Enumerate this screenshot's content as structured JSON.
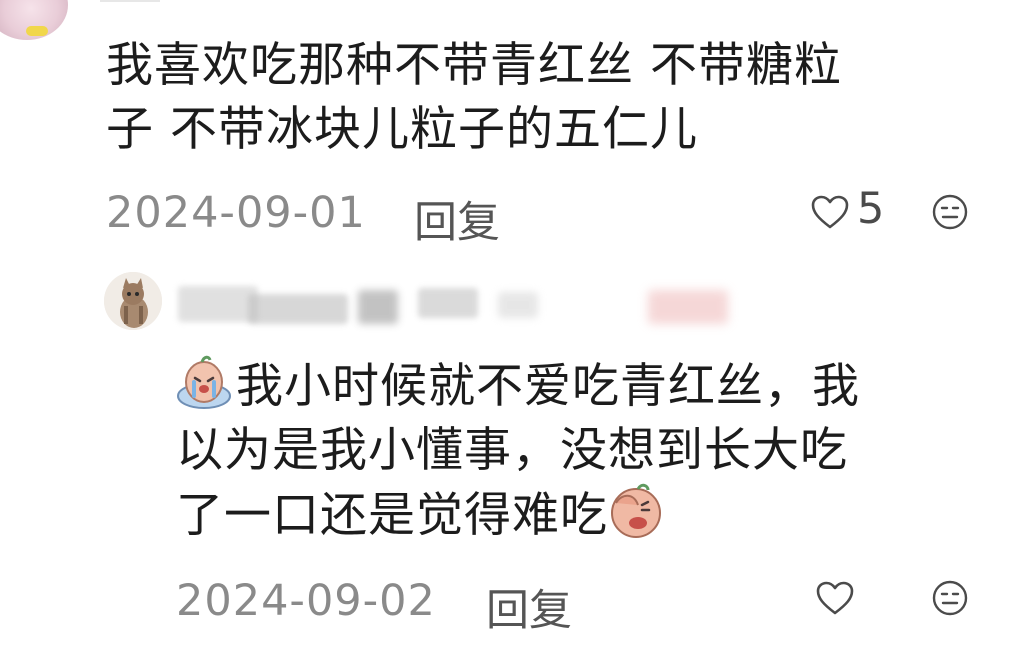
{
  "comments": [
    {
      "text_line1": "我喜欢吃那种不带青红丝 不带糖粒",
      "text_line2": "子 不带冰块儿粒子的五仁儿",
      "date": "2024-09-01",
      "reply_label": "回复",
      "like_count": "5"
    },
    {
      "text_line1": "我小时候就不爱吃青红丝，我",
      "text_line2": "以为是我小懂事，没想到长大吃",
      "text_line3": "了一口还是觉得难吃",
      "date": "2024-09-02",
      "reply_label": "回复"
    }
  ],
  "icons": {
    "like": "heart-outline-icon",
    "dislike": "meh-face-icon",
    "emoji_cry": "crying-emoji",
    "emoji_facepalm": "facepalm-emoji"
  },
  "colors": {
    "text": "#1c1c1c",
    "meta": "#8a8a8a",
    "icon": "#4b4b4b"
  }
}
